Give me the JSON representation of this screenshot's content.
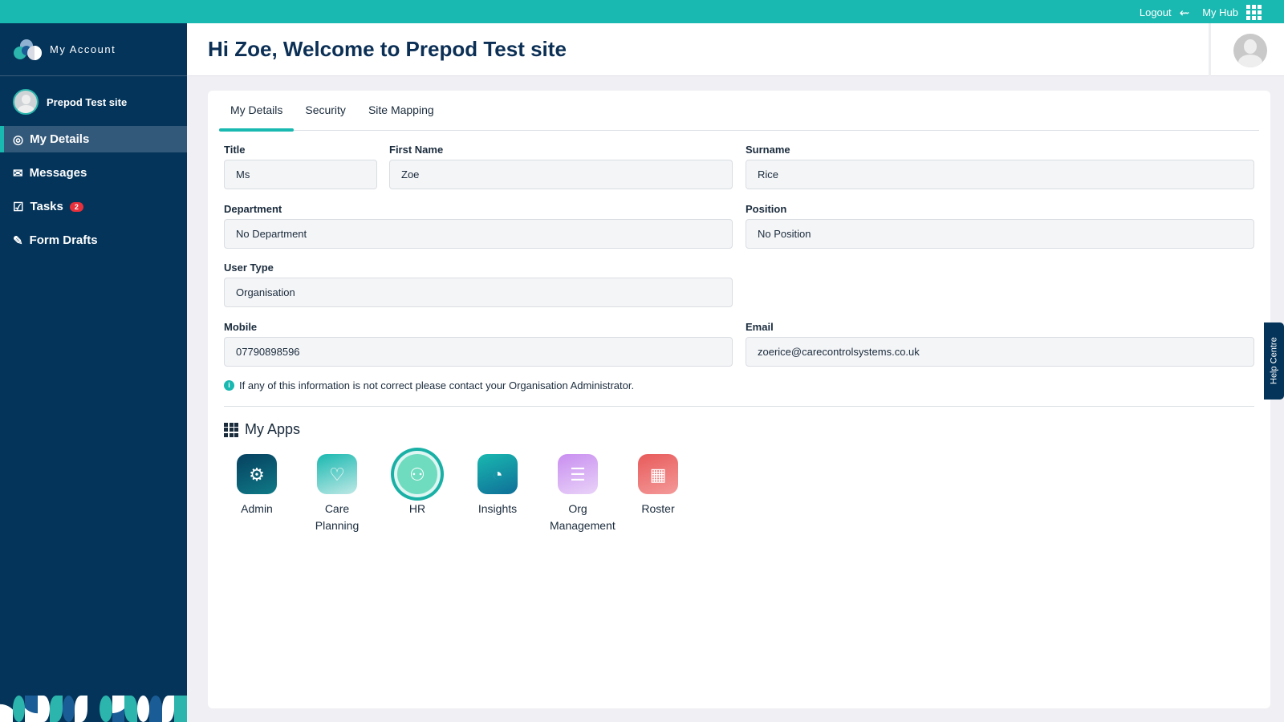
{
  "topbar": {
    "logout": "Logout",
    "hub": "My Hub"
  },
  "sidebar": {
    "brand": "My Account",
    "site": "Prepod Test site",
    "items": [
      {
        "label": "My Details"
      },
      {
        "label": "Messages"
      },
      {
        "label": "Tasks",
        "badge": "2"
      },
      {
        "label": "Form Drafts"
      }
    ]
  },
  "header": {
    "title": "Hi Zoe, Welcome to Prepod Test site"
  },
  "tabs": [
    "My Details",
    "Security",
    "Site Mapping"
  ],
  "form": {
    "title": {
      "label": "Title",
      "value": "Ms"
    },
    "first": {
      "label": "First Name",
      "value": "Zoe"
    },
    "surname": {
      "label": "Surname",
      "value": "Rice"
    },
    "dept": {
      "label": "Department",
      "value": "No Department"
    },
    "position": {
      "label": "Position",
      "value": "No Position"
    },
    "usertype": {
      "label": "User Type",
      "value": "Organisation"
    },
    "mobile": {
      "label": "Mobile",
      "value": "07790898596"
    },
    "email": {
      "label": "Email",
      "value": "zoerice@carecontrolsystems.co.uk"
    },
    "info": "If any of this information is not correct please contact your Organisation Administrator."
  },
  "apps": {
    "title": "My Apps",
    "items": [
      {
        "label": "Admin"
      },
      {
        "label": "Care Planning"
      },
      {
        "label": "HR"
      },
      {
        "label": "Insights"
      },
      {
        "label": "Org Management"
      },
      {
        "label": "Roster"
      }
    ]
  },
  "help": "Help Centre",
  "colors": {
    "accent": "#19b8b0",
    "sidebar": "#04345a",
    "badge": "#e8303c"
  }
}
